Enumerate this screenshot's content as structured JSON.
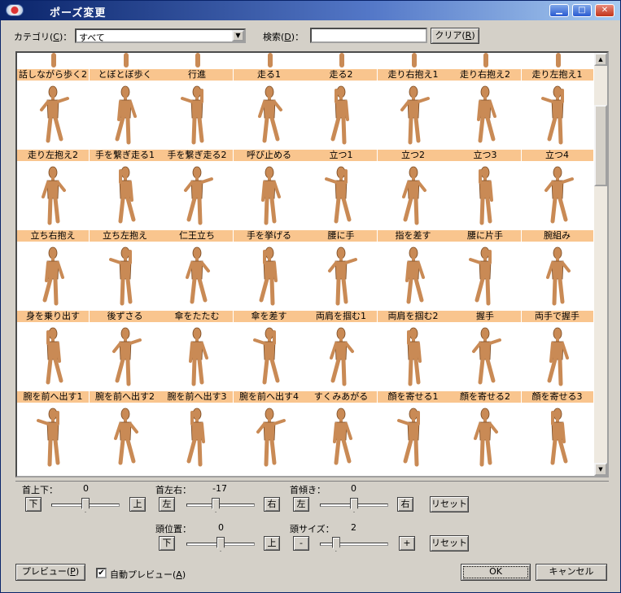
{
  "window": {
    "title": "ポーズ変更",
    "min_icon": "minimize-icon",
    "max_icon": "maximize-icon",
    "close_icon": "close-icon"
  },
  "filter": {
    "category_label": "カテゴリ(",
    "category_key": "C",
    "category_suffix": ")：",
    "category_value": "すべて",
    "search_label": "検索(",
    "search_key": "D",
    "search_suffix": ")：",
    "search_value": "",
    "clear_label": "クリア(",
    "clear_key": "R",
    "clear_suffix": ")"
  },
  "poses": {
    "partial_labels": [
      "話しながら歩く2",
      "とぼとぼ歩く",
      "行進",
      "走る1",
      "走る2",
      "走り右抱え1",
      "走り右抱え2",
      "走り左抱え1"
    ],
    "rows": [
      [
        "走り左抱え2",
        "手を繋ぎ走る1",
        "手を繋ぎ走る2",
        "呼び止める",
        "立つ1",
        "立つ2",
        "立つ3",
        "立つ4"
      ],
      [
        "立ち右抱え",
        "立ち左抱え",
        "仁王立ち",
        "手を挙げる",
        "腰に手",
        "指を差す",
        "腰に片手",
        "腕組み"
      ],
      [
        "身を乗り出す",
        "後ずさる",
        "傘をたたむ",
        "傘を差す",
        "両肩を掴む1",
        "両肩を掴む2",
        "握手",
        "両手で握手"
      ],
      [
        "腕を前へ出す1",
        "腕を前へ出す2",
        "腕を前へ出す3",
        "腕を前へ出す4",
        "すくみあがる",
        "顔を寄せる1",
        "顔を寄せる2",
        "顔を寄せる3"
      ],
      [
        "",
        "",
        "",
        "",
        "",
        "",
        "",
        ""
      ]
    ]
  },
  "controls": {
    "neck_updown": {
      "label": "首上下：",
      "value": "0",
      "down": "下",
      "up": "上",
      "level": 0.5
    },
    "neck_leftright": {
      "label": "首左右：",
      "value": "-17",
      "left": "左",
      "right": "右",
      "level": 0.42
    },
    "neck_tilt": {
      "label": "首傾き：",
      "value": "0",
      "left": "左",
      "right": "右",
      "level": 0.5
    },
    "reset1": "リセット",
    "head_position": {
      "label": "頭位置：",
      "value": "0",
      "down": "下",
      "up": "上",
      "level": 0.5
    },
    "head_size": {
      "label": "頭サイズ：",
      "value": "2",
      "minus": "-",
      "plus": "+",
      "level": 0.2
    },
    "reset2": "リセット"
  },
  "footer": {
    "preview_label": "プレビュー(",
    "preview_key": "P",
    "preview_suffix": ")",
    "auto_preview_label": "自動プレビュー(",
    "auto_preview_key": "A",
    "auto_preview_suffix": ")",
    "auto_preview_checked": true,
    "ok": "OK",
    "cancel": "キャンセル"
  },
  "colors": {
    "label_bg": "#f9c58e",
    "figure": "#c98a55",
    "title_start": "#0a246a"
  }
}
